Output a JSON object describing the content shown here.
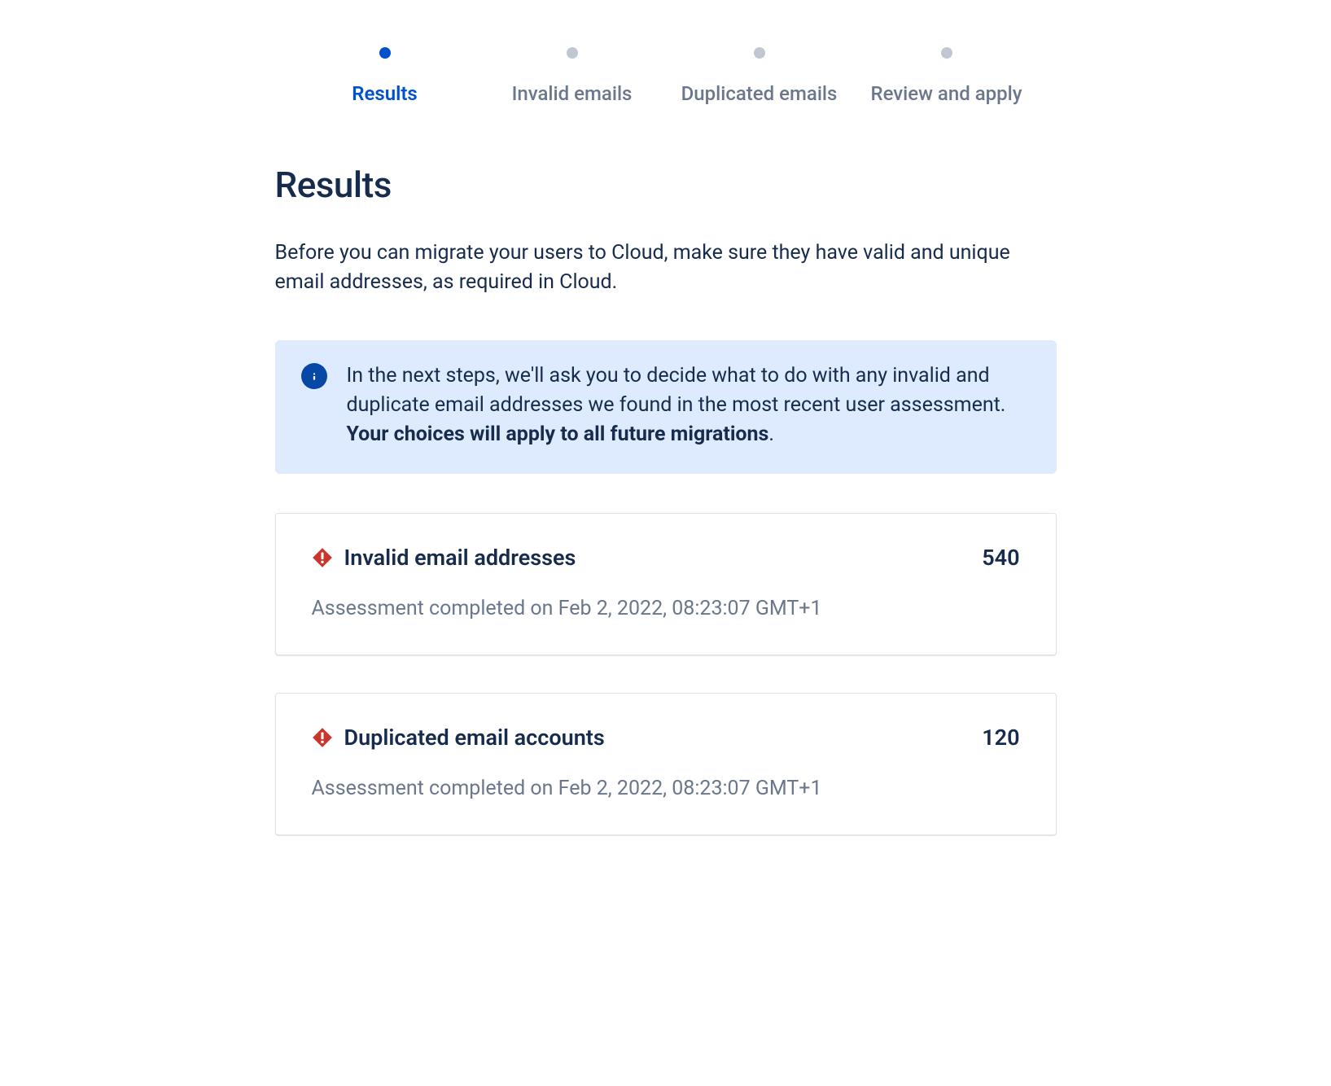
{
  "stepper": {
    "steps": [
      {
        "label": "Results",
        "active": true
      },
      {
        "label": "Invalid emails",
        "active": false
      },
      {
        "label": "Duplicated emails",
        "active": false
      },
      {
        "label": "Review and apply",
        "active": false
      }
    ]
  },
  "page": {
    "title": "Results",
    "intro": "Before you can migrate your users to Cloud, make sure they have valid and unique email addresses, as required in Cloud."
  },
  "banner": {
    "text_part1": "In the next steps, we'll ask you to decide what to do with any invalid and duplicate email addresses we found in the most recent user assessment. ",
    "text_bold": "Your choices will apply to all future migrations",
    "text_suffix": "."
  },
  "cards": [
    {
      "title": "Invalid email addresses",
      "count": "540",
      "subtext": "Assessment completed on Feb 2, 2022, 08:23:07 GMT+1"
    },
    {
      "title": "Duplicated email accounts",
      "count": "120",
      "subtext": "Assessment completed on Feb 2, 2022, 08:23:07 GMT+1"
    }
  ]
}
